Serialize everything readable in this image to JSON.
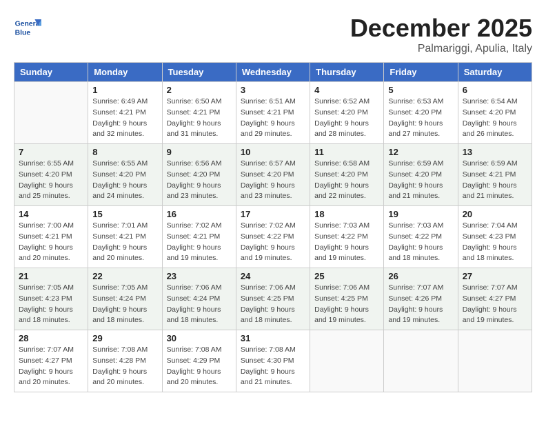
{
  "header": {
    "logo_line1": "General",
    "logo_line2": "Blue",
    "month": "December 2025",
    "location": "Palmariggi, Apulia, Italy"
  },
  "days_of_week": [
    "Sunday",
    "Monday",
    "Tuesday",
    "Wednesday",
    "Thursday",
    "Friday",
    "Saturday"
  ],
  "weeks": [
    [
      {
        "num": "",
        "empty": true
      },
      {
        "num": "1",
        "sunrise": "6:49 AM",
        "sunset": "4:21 PM",
        "daylight": "9 hours and 32 minutes."
      },
      {
        "num": "2",
        "sunrise": "6:50 AM",
        "sunset": "4:21 PM",
        "daylight": "9 hours and 31 minutes."
      },
      {
        "num": "3",
        "sunrise": "6:51 AM",
        "sunset": "4:21 PM",
        "daylight": "9 hours and 29 minutes."
      },
      {
        "num": "4",
        "sunrise": "6:52 AM",
        "sunset": "4:20 PM",
        "daylight": "9 hours and 28 minutes."
      },
      {
        "num": "5",
        "sunrise": "6:53 AM",
        "sunset": "4:20 PM",
        "daylight": "9 hours and 27 minutes."
      },
      {
        "num": "6",
        "sunrise": "6:54 AM",
        "sunset": "4:20 PM",
        "daylight": "9 hours and 26 minutes."
      }
    ],
    [
      {
        "num": "7",
        "sunrise": "6:55 AM",
        "sunset": "4:20 PM",
        "daylight": "9 hours and 25 minutes."
      },
      {
        "num": "8",
        "sunrise": "6:55 AM",
        "sunset": "4:20 PM",
        "daylight": "9 hours and 24 minutes."
      },
      {
        "num": "9",
        "sunrise": "6:56 AM",
        "sunset": "4:20 PM",
        "daylight": "9 hours and 23 minutes."
      },
      {
        "num": "10",
        "sunrise": "6:57 AM",
        "sunset": "4:20 PM",
        "daylight": "9 hours and 23 minutes."
      },
      {
        "num": "11",
        "sunrise": "6:58 AM",
        "sunset": "4:20 PM",
        "daylight": "9 hours and 22 minutes."
      },
      {
        "num": "12",
        "sunrise": "6:59 AM",
        "sunset": "4:20 PM",
        "daylight": "9 hours and 21 minutes."
      },
      {
        "num": "13",
        "sunrise": "6:59 AM",
        "sunset": "4:21 PM",
        "daylight": "9 hours and 21 minutes."
      }
    ],
    [
      {
        "num": "14",
        "sunrise": "7:00 AM",
        "sunset": "4:21 PM",
        "daylight": "9 hours and 20 minutes."
      },
      {
        "num": "15",
        "sunrise": "7:01 AM",
        "sunset": "4:21 PM",
        "daylight": "9 hours and 20 minutes."
      },
      {
        "num": "16",
        "sunrise": "7:02 AM",
        "sunset": "4:21 PM",
        "daylight": "9 hours and 19 minutes."
      },
      {
        "num": "17",
        "sunrise": "7:02 AM",
        "sunset": "4:22 PM",
        "daylight": "9 hours and 19 minutes."
      },
      {
        "num": "18",
        "sunrise": "7:03 AM",
        "sunset": "4:22 PM",
        "daylight": "9 hours and 19 minutes."
      },
      {
        "num": "19",
        "sunrise": "7:03 AM",
        "sunset": "4:22 PM",
        "daylight": "9 hours and 18 minutes."
      },
      {
        "num": "20",
        "sunrise": "7:04 AM",
        "sunset": "4:23 PM",
        "daylight": "9 hours and 18 minutes."
      }
    ],
    [
      {
        "num": "21",
        "sunrise": "7:05 AM",
        "sunset": "4:23 PM",
        "daylight": "9 hours and 18 minutes."
      },
      {
        "num": "22",
        "sunrise": "7:05 AM",
        "sunset": "4:24 PM",
        "daylight": "9 hours and 18 minutes."
      },
      {
        "num": "23",
        "sunrise": "7:06 AM",
        "sunset": "4:24 PM",
        "daylight": "9 hours and 18 minutes."
      },
      {
        "num": "24",
        "sunrise": "7:06 AM",
        "sunset": "4:25 PM",
        "daylight": "9 hours and 18 minutes."
      },
      {
        "num": "25",
        "sunrise": "7:06 AM",
        "sunset": "4:25 PM",
        "daylight": "9 hours and 19 minutes."
      },
      {
        "num": "26",
        "sunrise": "7:07 AM",
        "sunset": "4:26 PM",
        "daylight": "9 hours and 19 minutes."
      },
      {
        "num": "27",
        "sunrise": "7:07 AM",
        "sunset": "4:27 PM",
        "daylight": "9 hours and 19 minutes."
      }
    ],
    [
      {
        "num": "28",
        "sunrise": "7:07 AM",
        "sunset": "4:27 PM",
        "daylight": "9 hours and 20 minutes."
      },
      {
        "num": "29",
        "sunrise": "7:08 AM",
        "sunset": "4:28 PM",
        "daylight": "9 hours and 20 minutes."
      },
      {
        "num": "30",
        "sunrise": "7:08 AM",
        "sunset": "4:29 PM",
        "daylight": "9 hours and 20 minutes."
      },
      {
        "num": "31",
        "sunrise": "7:08 AM",
        "sunset": "4:30 PM",
        "daylight": "9 hours and 21 minutes."
      },
      {
        "num": "",
        "empty": true
      },
      {
        "num": "",
        "empty": true
      },
      {
        "num": "",
        "empty": true
      }
    ]
  ],
  "labels": {
    "sunrise_label": "Sunrise:",
    "sunset_label": "Sunset:",
    "daylight_label": "Daylight:"
  }
}
